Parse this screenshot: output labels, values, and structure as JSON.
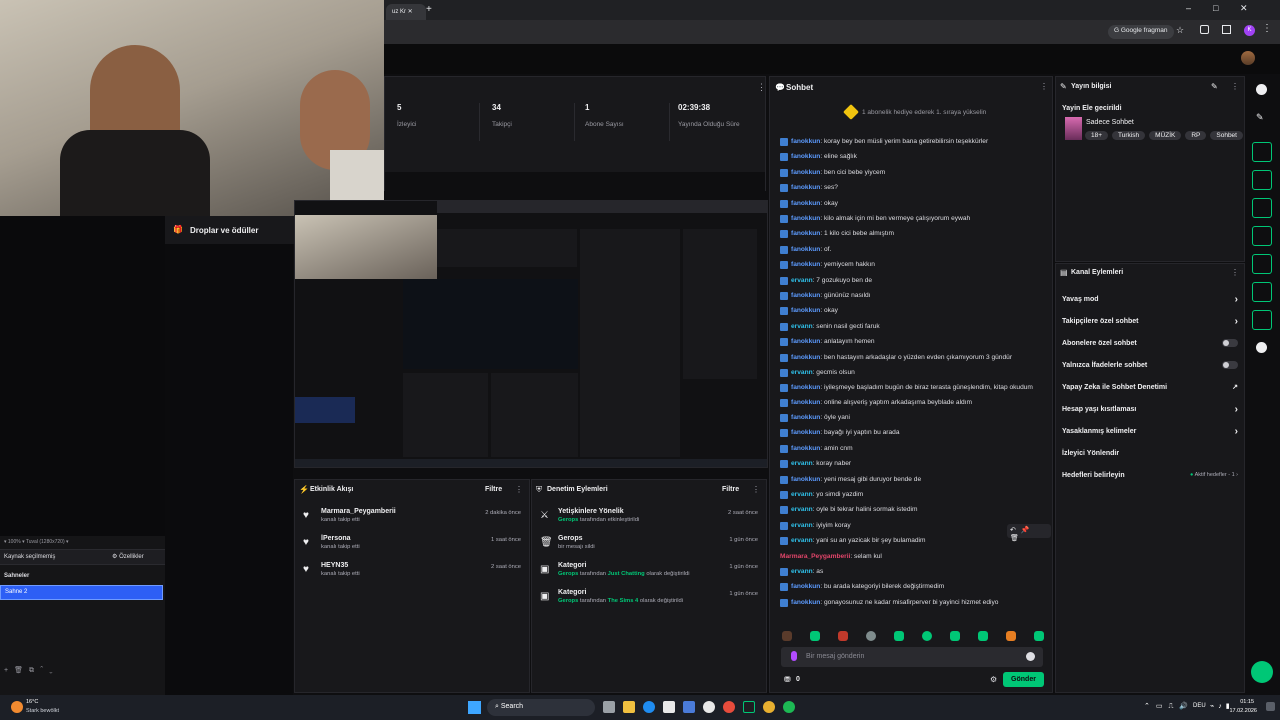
{
  "browser": {
    "tab_label": "uz Kr",
    "new_tab": "+",
    "google_label": "Google fragman",
    "profile": "K",
    "win_min": "–",
    "win_max": "□",
    "win_close": "✕"
  },
  "stats": [
    {
      "value": "5",
      "label": "İzleyici"
    },
    {
      "value": "34",
      "label": "Takipçi"
    },
    {
      "value": "1",
      "label": "Abone Sayısı"
    },
    {
      "value": "02:39:38",
      "label": "Yayında Olduğu Süre"
    }
  ],
  "drops": {
    "title": "Droplar ve ödüller"
  },
  "obs": {
    "zoom": "100%",
    "canvas": "Tuval (1280x720)",
    "source_prompt": "Kaynak seçilmemiş",
    "properties": "Özellikler",
    "scenes_header": "Sahneler",
    "scene_selected": "Sahne 2"
  },
  "activity": {
    "title": "Etkinlik Akışı",
    "filter": "Filtre",
    "items": [
      {
        "name": "Marmara_Peygamberii",
        "sub": "kanalı takip etti",
        "time": "2 dakika önce"
      },
      {
        "name": "lPersona",
        "sub": "kanalı takip etti",
        "time": "1 saat önce"
      },
      {
        "name": "HEYN35",
        "sub": "kanalı takip etti",
        "time": "2 saat önce"
      }
    ]
  },
  "mod_actions": {
    "title": "Denetim Eylemleri",
    "filter": "Filtre",
    "items": [
      {
        "name": "Yetişkinlere Yönelik",
        "user": "Gerops",
        "pre": "tarafından etkinleştirildi",
        "hl": "",
        "post": "",
        "time": "2 saat önce"
      },
      {
        "name": "Gerops",
        "user": "",
        "pre": "bir mesajı sildi",
        "hl": "",
        "post": "",
        "time": "1 gün önce"
      },
      {
        "name": "Kategori",
        "user": "Gerops",
        "pre": "tarafından",
        "hl": "Just Chatting",
        "post": "olarak değiştirildi",
        "time": "1 gün önce"
      },
      {
        "name": "Kategori",
        "user": "Gerops",
        "pre": "tarafından",
        "hl": "The Sims 4",
        "post": "olarak değiştirildi",
        "time": "1 gün önce"
      }
    ]
  },
  "chat": {
    "title": "Sohbet",
    "banner": "1 abonelik hediye ederek 1. sıraya yükselin",
    "input_placeholder": "Bir mesaj gönderin",
    "send": "Gönder",
    "points": "0",
    "messages": [
      {
        "user": "fanokkun",
        "color": "u1",
        "text": "koray bey ben müsli yerim bana getirebilirsin teşekkürler"
      },
      {
        "user": "fanokkun",
        "color": "u1",
        "text": "eline sağlık"
      },
      {
        "user": "fanokkun",
        "color": "u1",
        "text": "ben cici bebe yiycem"
      },
      {
        "user": "fanokkun",
        "color": "u1",
        "text": "ses?"
      },
      {
        "user": "fanokkun",
        "color": "u1",
        "text": "okay"
      },
      {
        "user": "fanokkun",
        "color": "u1",
        "text": "kilo almak için mi ben vermeye çalışıyorum eywah"
      },
      {
        "user": "fanokkun",
        "color": "u1",
        "text": "1 kilo cici bebe almıştım"
      },
      {
        "user": "fanokkun",
        "color": "u1",
        "text": "of."
      },
      {
        "user": "fanokkun",
        "color": "u1",
        "text": "yemiycem hakkın"
      },
      {
        "user": "ervann",
        "color": "u2",
        "text": "7 gozukuyo ben de"
      },
      {
        "user": "fanokkun",
        "color": "u1",
        "text": "gününüz nasıldı"
      },
      {
        "user": "fanokkun",
        "color": "u1",
        "text": "okay"
      },
      {
        "user": "ervann",
        "color": "u2",
        "text": "senin nasil gecti faruk"
      },
      {
        "user": "fanokkun",
        "color": "u1",
        "text": "anlatayım hemen"
      },
      {
        "user": "fanokkun",
        "color": "u1",
        "text": "ben hastayım arkadaşlar o yüzden evden çıkamıyorum 3 gündür"
      },
      {
        "user": "ervann",
        "color": "u2",
        "text": "gecmis olsun"
      },
      {
        "user": "fanokkun",
        "color": "u1",
        "text": "iyileşmeye başladım bugün de biraz terasta güneşlendim, kitap okudum",
        "wrap": true
      },
      {
        "user": "fanokkun",
        "color": "u1",
        "text": "online alışveriş yaptım arkadaşıma beyblade aldım"
      },
      {
        "user": "fanokkun",
        "color": "u1",
        "text": "öyle yani"
      },
      {
        "user": "fanokkun",
        "color": "u1",
        "text": "bayağı iyi yaptın bu arada"
      },
      {
        "user": "fanokkun",
        "color": "u1",
        "text": "amin cnm"
      },
      {
        "user": "ervann",
        "color": "u2",
        "text": "koray naber"
      },
      {
        "user": "fanokkun",
        "color": "u1",
        "text": "yeni mesaj gibi duruyor bende de"
      },
      {
        "user": "ervann",
        "color": "u2",
        "text": "yo simdi yazdim"
      },
      {
        "user": "ervann",
        "color": "u2",
        "text": "oyle bi tekrar halini sormak istedim"
      },
      {
        "user": "ervann",
        "color": "u2",
        "text": "iyiyim koray"
      },
      {
        "user": "ervann",
        "color": "u2",
        "text": "yani su an yazicak bir şey bulamadim"
      },
      {
        "user": "Marmara_Peygamberii",
        "color": "u3",
        "text": "selam kul",
        "nobadge": true
      },
      {
        "user": "ervann",
        "color": "u2",
        "text": "as"
      },
      {
        "user": "fanokkun",
        "color": "u1",
        "text": "bu arada kategoriyi bilerek değiştirmedim"
      },
      {
        "user": "fanokkun",
        "color": "u1",
        "text": "gonayosunuz ne kadar misafirperver bi yayinci hizmet ediyo"
      }
    ]
  },
  "stream_info": {
    "title": "Yayın bilgisi",
    "stream_title": "Yayin Ele gecirildi",
    "category": "Sadece Sohbet",
    "tags": [
      "18+",
      "Turkish",
      "MÜZİK",
      "RP",
      "Sohbet"
    ]
  },
  "channel_actions": {
    "title": "Kanal Eylemleri",
    "items": [
      {
        "label": "Yavaş mod",
        "type": "chevron"
      },
      {
        "label": "Takipçilere özel sohbet",
        "type": "chevron"
      },
      {
        "label": "Abonelere özel sohbet",
        "type": "toggle"
      },
      {
        "label": "Yalnızca İfadelerle sohbet",
        "type": "toggle"
      },
      {
        "label": "Yapay Zeka ile Sohbet Denetimi",
        "type": "external"
      },
      {
        "label": "Hesap yaşı kısıtlaması",
        "type": "chevron"
      },
      {
        "label": "Yasaklanmış kelimeler",
        "type": "chevron"
      },
      {
        "label": "İzleyici Yönlendir",
        "type": "none"
      },
      {
        "label": "Hedefleri belirleyin",
        "type": "goal",
        "extra": "Aktif hedefler - 1"
      }
    ]
  },
  "taskbar": {
    "weather_temp": "16°C",
    "weather_desc": "Stark bewölkt",
    "search": "Search",
    "lang": "DEU",
    "time": "01:15",
    "date": "17.02.2026"
  },
  "colors": {
    "accent": "#00c776",
    "bg": "#0e0e10",
    "panel": "#18181b"
  }
}
